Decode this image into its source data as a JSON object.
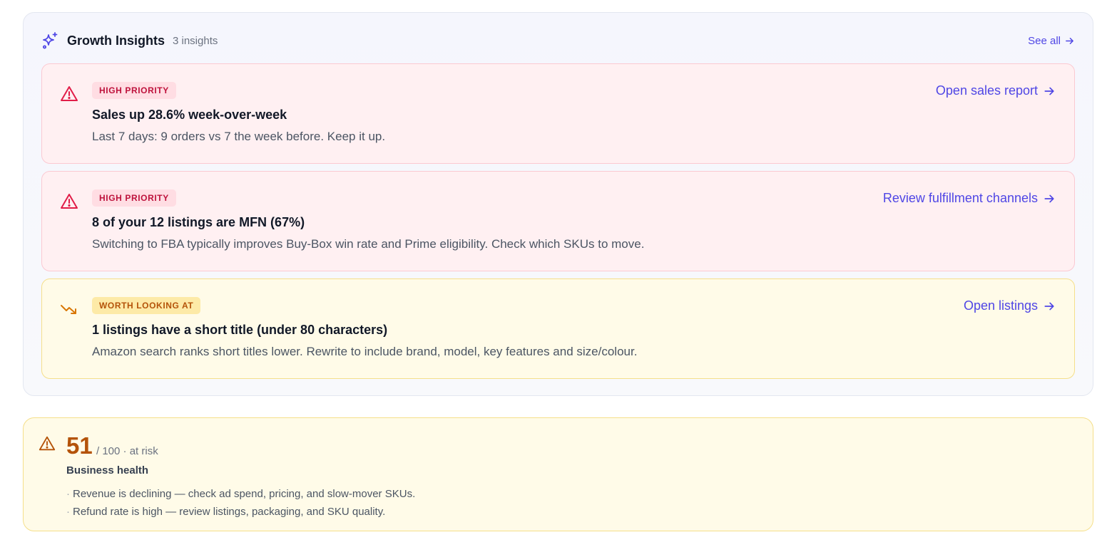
{
  "insights": {
    "title": "Growth Insights",
    "count": "3 insights",
    "see_all": "See all",
    "cards": [
      {
        "level": "high",
        "icon": "alert-triangle-icon",
        "badge": "HIGH PRIORITY",
        "title": "Sales up 28.6% week-over-week",
        "description": "Last 7 days: 9 orders vs 7 the week before. Keep it up.",
        "action": "Open sales report"
      },
      {
        "level": "high",
        "icon": "alert-triangle-icon",
        "badge": "HIGH PRIORITY",
        "title": "8 of your 12 listings are MFN (67%)",
        "description": "Switching to FBA typically improves Buy-Box win rate and Prime eligibility. Check which SKUs to move.",
        "action": "Review fulfillment channels"
      },
      {
        "level": "warn",
        "icon": "trending-down-icon",
        "badge": "WORTH LOOKING AT",
        "title": "1 listings have a short title (under 80 characters)",
        "description": "Amazon search ranks short titles lower. Rewrite to include brand, model, key features and size/colour.",
        "action": "Open listings"
      }
    ]
  },
  "health": {
    "score": "51",
    "scale": "/ 100 · at risk",
    "label": "Business health",
    "items": [
      "Revenue is declining — check ad spend, pricing, and slow-mover SKUs.",
      "Refund rate is high — review listings, packaging, and SKU quality."
    ]
  },
  "colors": {
    "accent": "#4f46e5",
    "high_bg": "#fff0f2",
    "high_text": "#be123c",
    "warn_bg": "#fffbe8",
    "warn_text": "#b45309"
  }
}
